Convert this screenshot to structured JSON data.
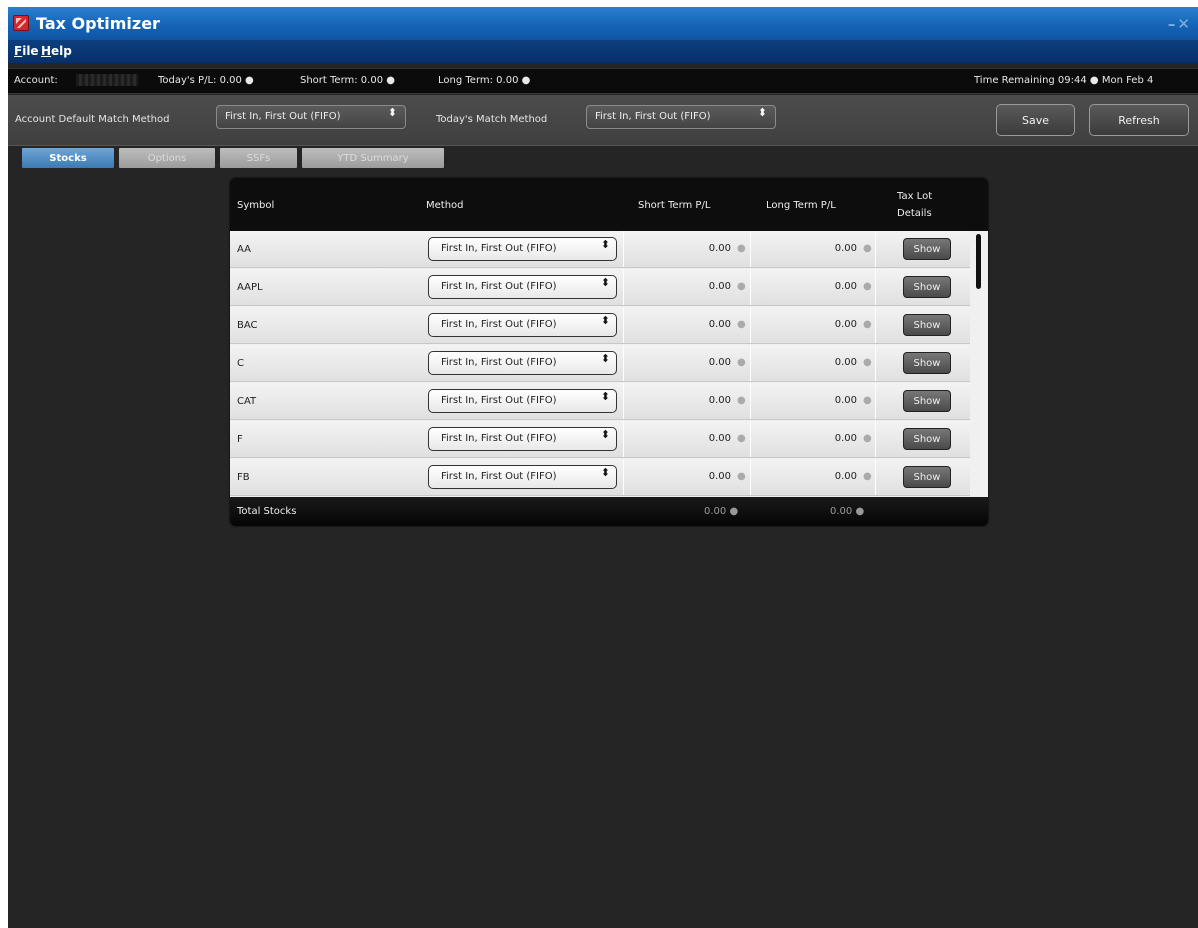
{
  "window": {
    "title": "Tax Optimizer",
    "controls": "–✕"
  },
  "menu": [
    {
      "label": "File",
      "accel": "F",
      "rest": "ile"
    },
    {
      "label": "Help",
      "accel": "H",
      "rest": "elp"
    }
  ],
  "status": {
    "account_label": "Account:",
    "todays_pl": "Today's P/L:  0.00 ●",
    "short_term": "Short Term:  0.00 ●",
    "long_term": "Long Term:  0.00 ●",
    "time_remaining": "Time Remaining 09:44 ● Mon Feb 4"
  },
  "toolbar": {
    "account_default_label": "Account Default Match Method",
    "account_default_value": "First In, First Out (FIFO)",
    "todays_label": "Today's Match Method",
    "todays_value": "First In, First Out (FIFO)",
    "save_label": "Save",
    "refresh_label": "Refresh"
  },
  "tabs": [
    {
      "label": "Stocks",
      "active": true
    },
    {
      "label": "Options",
      "active": false
    },
    {
      "label": "SSFs",
      "active": false
    },
    {
      "label": "YTD Summary",
      "active": false
    }
  ],
  "table": {
    "headers": {
      "symbol": "Symbol",
      "method": "Method",
      "short_term": "Short Term P/L",
      "long_term": "Long Term P/L",
      "tax_lot_line1": "Tax Lot",
      "tax_lot_line2": "Details"
    },
    "rows": [
      {
        "symbol": "AA",
        "method": "First In, First Out (FIFO)",
        "short": "0.00",
        "long": "0.00",
        "action": "Show"
      },
      {
        "symbol": "AAPL",
        "method": "First In, First Out (FIFO)",
        "short": "0.00",
        "long": "0.00",
        "action": "Show"
      },
      {
        "symbol": "BAC",
        "method": "First In, First Out (FIFO)",
        "short": "0.00",
        "long": "0.00",
        "action": "Show"
      },
      {
        "symbol": "C",
        "method": "First In, First Out (FIFO)",
        "short": "0.00",
        "long": "0.00",
        "action": "Show"
      },
      {
        "symbol": "CAT",
        "method": "First In, First Out (FIFO)",
        "short": "0.00",
        "long": "0.00",
        "action": "Show"
      },
      {
        "symbol": "F",
        "method": "First In, First Out (FIFO)",
        "short": "0.00",
        "long": "0.00",
        "action": "Show"
      },
      {
        "symbol": "FB",
        "method": "First In, First Out (FIFO)",
        "short": "0.00",
        "long": "0.00",
        "action": "Show"
      }
    ],
    "footer": {
      "label": "Total Stocks",
      "short": "0.00 ●",
      "long": "0.00 ●"
    },
    "cell_dot": "●",
    "arrows": "⬍"
  }
}
